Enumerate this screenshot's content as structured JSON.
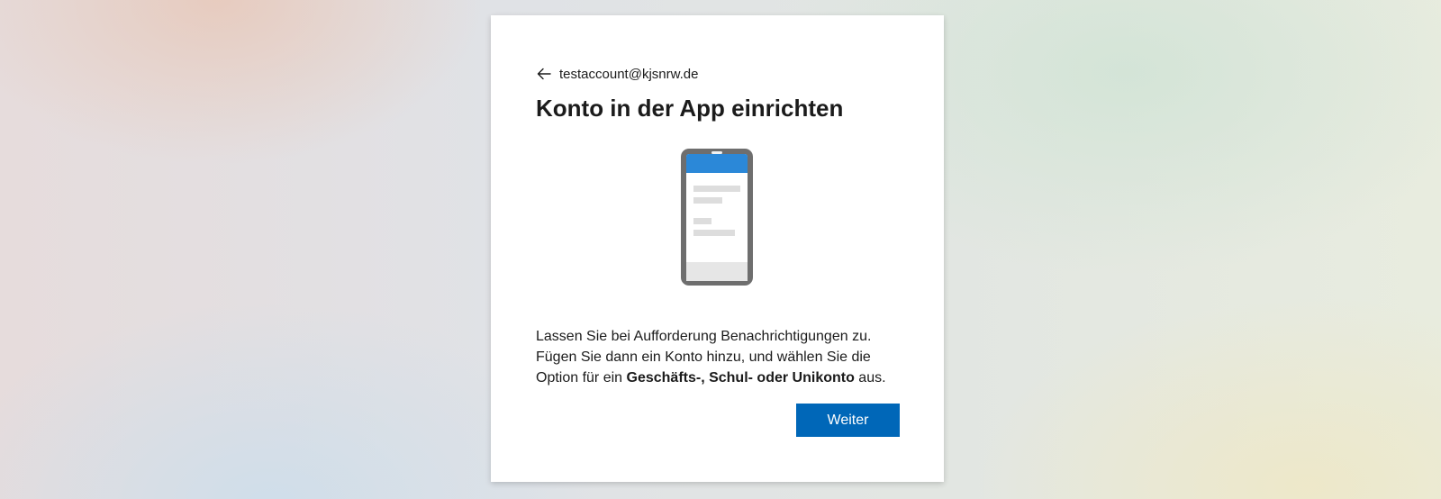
{
  "account": {
    "email": "testaccount@kjsnrw.de",
    "back_icon": "arrow-left-icon"
  },
  "page": {
    "title": "Konto in der App einrichten"
  },
  "illustration": {
    "icon": "smartphone-icon",
    "colors": {
      "frame": "#6e6e6e",
      "header": "#2b88d8",
      "screen": "#ffffff",
      "placeholder": "#dddddd",
      "footer": "#e6e6e6"
    }
  },
  "description": {
    "line1": "Lassen Sie bei Aufforderung Benachrichtigungen zu.",
    "line2": "Fügen Sie dann ein Konto hinzu, und wählen Sie die",
    "line3_prefix": "Option für ein ",
    "line3_bold": "Geschäfts-, Schul- oder Unikonto",
    "line3_suffix": " aus."
  },
  "actions": {
    "next_label": "Weiter"
  },
  "colors": {
    "accent": "#0067b8",
    "text": "#1b1b1b",
    "card_background": "#ffffff"
  }
}
